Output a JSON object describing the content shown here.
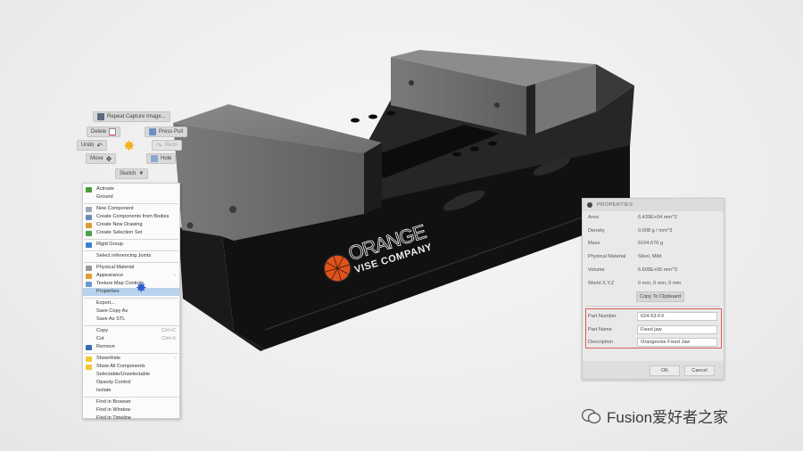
{
  "marking_menu": {
    "repeat": "Repeat Capture Image...",
    "delete": "Delete",
    "press_pull": "Press Pull",
    "undo": "Undo",
    "redo": "Redo",
    "move": "Move",
    "hole": "Hole",
    "sketch": "Sketch"
  },
  "context_menu": {
    "groups": [
      [
        {
          "label": "Activate",
          "icon": "check-icon",
          "color": "#4a9a3a"
        },
        {
          "label": "Ground"
        }
      ],
      [
        {
          "label": "New Component",
          "icon": "component-icon",
          "color": "#9aa7b8"
        },
        {
          "label": "Create Components from Bodies",
          "icon": "bodies-icon",
          "color": "#6a8bb8"
        },
        {
          "label": "Create New Drawing",
          "icon": "drawing-icon",
          "color": "#e09a2a"
        },
        {
          "label": "Create Selection Set",
          "icon": "selection-set-icon",
          "color": "#4aa048"
        }
      ],
      [
        {
          "label": "Rigid Group",
          "icon": "rigid-group-icon",
          "color": "#3a7fd0"
        }
      ],
      [
        {
          "label": "Select referencing Joints"
        }
      ],
      [
        {
          "label": "Physical Material",
          "icon": "material-icon",
          "color": "#999"
        },
        {
          "label": "Appearance",
          "icon": "appearance-icon",
          "color": "#e0a030",
          "submenu": "›"
        },
        {
          "label": "Texture Map Controls",
          "icon": "texture-icon",
          "color": "#6a9ad0"
        },
        {
          "label": "Properties",
          "highlight": true
        }
      ],
      [
        {
          "label": "Export..."
        },
        {
          "label": "Save Copy As"
        },
        {
          "label": "Save As STL"
        }
      ],
      [
        {
          "label": "Copy",
          "shortcut": "Ctrl+C"
        },
        {
          "label": "Cut",
          "shortcut": "Ctrl+X"
        },
        {
          "label": "Remove",
          "icon": "remove-icon",
          "color": "#3a6ab0"
        }
      ],
      [
        {
          "label": "Show/Hide",
          "icon": "lightbulb-icon",
          "color": "#f0c830",
          "submenu": "›"
        },
        {
          "label": "Show All Components",
          "icon": "lightbulb-icon",
          "color": "#f0c830"
        },
        {
          "label": "Selectable/Unselectable"
        },
        {
          "label": "Opacity Control"
        },
        {
          "label": "Isolate"
        }
      ],
      [
        {
          "label": "Find in Browser"
        },
        {
          "label": "Find in Window"
        },
        {
          "label": "Find in Timeline"
        }
      ]
    ]
  },
  "properties": {
    "title": "PROPERTIES",
    "rows": [
      {
        "label": "Area",
        "value": "6.439E+04 mm^2"
      },
      {
        "label": "Density",
        "value": "0.008 g / mm^3"
      },
      {
        "label": "Mass",
        "value": "5104.676 g"
      },
      {
        "label": "Physical Material",
        "value": "Steel, Mild"
      },
      {
        "label": "Volume",
        "value": "6.605E+05 mm^3"
      },
      {
        "label": "World X,Y,Z",
        "value": "0 mm, 0 mm, 0 mm"
      }
    ],
    "copy_button": "Copy To Clipboard",
    "fields": [
      {
        "label": "Part Number",
        "value": "624-53-FX"
      },
      {
        "label": "Part Name",
        "value": "Fixed jaw"
      },
      {
        "label": "Description",
        "value": "Orangevise Fixed Jaw"
      }
    ],
    "ok": "OK",
    "cancel": "Cancel"
  },
  "logo": {
    "line1": "ORANGE",
    "line2": "VISE COMPANY",
    "color": "#e0521c"
  },
  "watermark": "Fusion爱好者之家"
}
